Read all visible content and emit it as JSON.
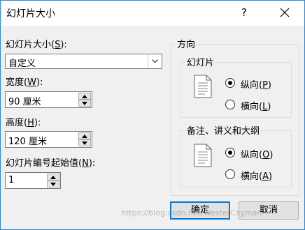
{
  "window": {
    "title": "幻灯片大小",
    "help_label": "?"
  },
  "slide_size": {
    "label": "幻灯片大小(S):",
    "label_prefix": "幻灯片大小(",
    "label_key": "S",
    "label_suffix": "):",
    "value": "自定义"
  },
  "width": {
    "label_prefix": "宽度(",
    "label_key": "W",
    "label_suffix": "):",
    "value": "90 厘米"
  },
  "height": {
    "label_prefix": "高度(",
    "label_key": "H",
    "label_suffix": "):",
    "value": "120 厘米"
  },
  "numbering": {
    "label_prefix": "幻灯片编号起始值(",
    "label_key": "N",
    "label_suffix": "):",
    "value": "1"
  },
  "orientation": {
    "title": "方向",
    "slides": {
      "title": "幻灯片",
      "portrait_prefix": "纵向(",
      "portrait_key": "P",
      "portrait_suffix": ")",
      "landscape_prefix": "横向(",
      "landscape_key": "L",
      "landscape_suffix": ")",
      "selected": "portrait"
    },
    "notes": {
      "title": "备注、讲义和大纲",
      "portrait_prefix": "纵向(",
      "portrait_key": "O",
      "portrait_suffix": ")",
      "landscape_prefix": "横向(",
      "landscape_key": "A",
      "landscape_suffix": ")",
      "selected": "portrait"
    }
  },
  "buttons": {
    "ok": "确定",
    "cancel": "取消"
  },
  "watermark": "https://blog.csdn.net/WesterCayman",
  "colors": {
    "accent": "#0078d7",
    "window_border": "#2b88d8",
    "dialog_bg": "#f0f0f0"
  }
}
